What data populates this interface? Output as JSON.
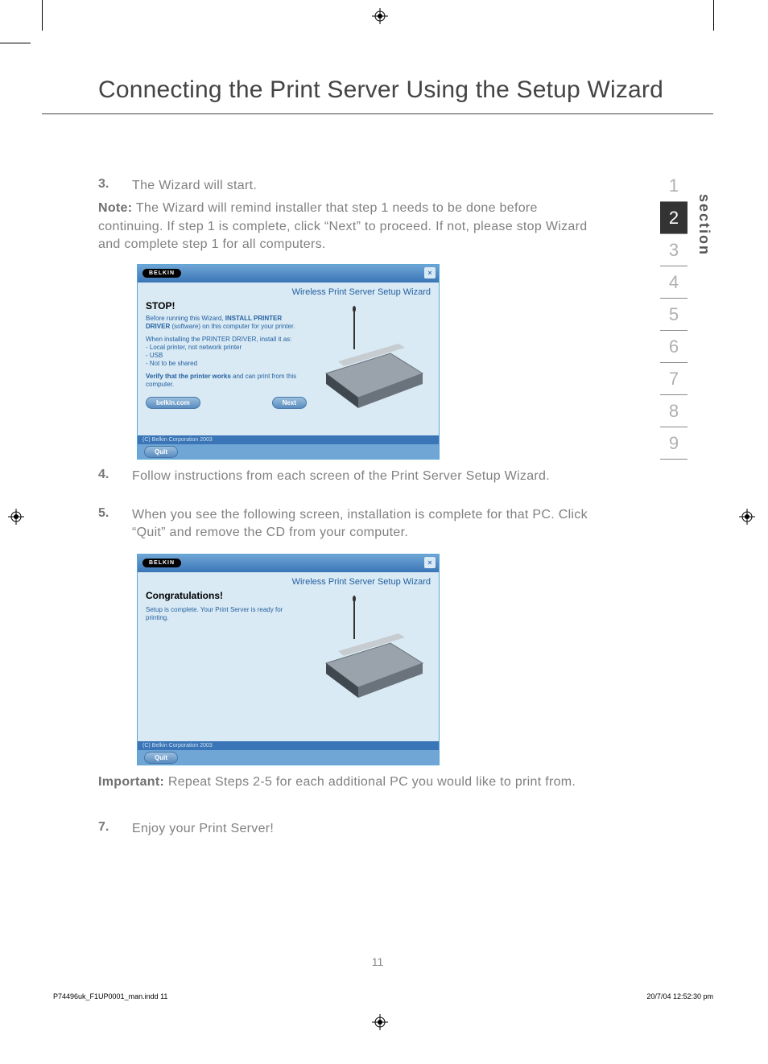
{
  "title": "Connecting the Print Server Using the Setup Wizard",
  "steps": {
    "s3": {
      "num": "3.",
      "text": "The Wizard will start."
    },
    "s4": {
      "num": "4.",
      "text": "Follow instructions from each screen of the Print Server Setup Wizard."
    },
    "s5": {
      "num": "5.",
      "text": "When you see the following screen, installation is complete for that PC. Click “Quit” and remove the CD from your computer."
    },
    "s7": {
      "num": "7.",
      "text": "Enjoy your Print Server!"
    }
  },
  "note_label": "Note:",
  "note_text": " The Wizard will remind installer that step 1 needs to be done before continuing. If step 1 is complete, click “Next” to proceed. If not, please stop Wizard and complete step 1 for all computers.",
  "important_label": "Important:",
  "important_text": " Repeat Steps 2-5 for each additional PC you would like to print from.",
  "wizard": {
    "logo": "BELKIN",
    "subtitle": "Wireless Print Server Setup Wizard",
    "stop": "STOP!",
    "line1a": "Before running this Wizard, ",
    "line1b": "INSTALL PRINTER DRIVER",
    "line1c": " (software) on this computer for your printer.",
    "line2a": "When installing the PRINTER DRIVER, install it as:",
    "line2b": "- Local printer, not network printer",
    "line2c": "- USB",
    "line2d": "- Not to be shared",
    "line3a": "Verify that the printer works",
    "line3b": " and can print from this computer.",
    "btn_belkin": "belkin.com",
    "btn_next": "Next",
    "btn_quit": "Quit",
    "copyright": "(C) Belkin Corporation 2003",
    "congrats": "Congratulations!",
    "done": "Setup is complete. Your Print Server is ready for printing."
  },
  "section": {
    "label": "section",
    "tabs": [
      "1",
      "2",
      "3",
      "4",
      "5",
      "6",
      "7",
      "8",
      "9"
    ],
    "active": "2"
  },
  "page_number": "11",
  "footer": {
    "left": "P74496uk_F1UP0001_man.indd   11",
    "right": "20/7/04   12:52:30 pm"
  }
}
